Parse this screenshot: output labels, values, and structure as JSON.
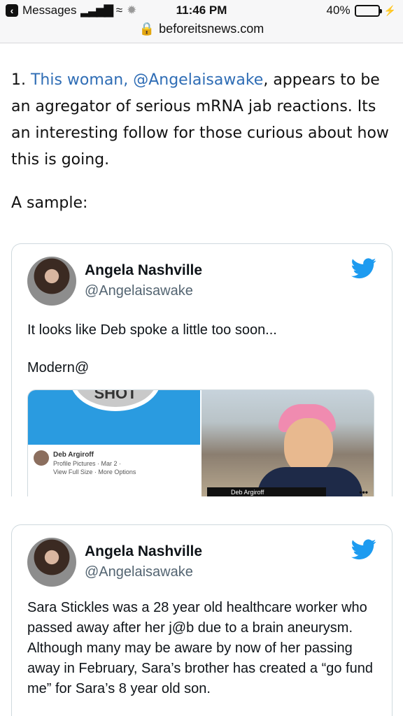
{
  "status_bar": {
    "back_app": "Messages",
    "time": "11:46 PM",
    "battery": "40%",
    "battery_level": 0.4
  },
  "browser": {
    "url": "beforeitsnews.com"
  },
  "article": {
    "para1_prefix": "1. ",
    "para1_link": "This woman, @Angelaisawake",
    "para1_rest": ", appears to be an agregator of serious mRNA jab reactions. Its an interesting follow for those curious about how this is going.",
    "para2": "A sample:"
  },
  "tweets": [
    {
      "name": "Angela Nashville",
      "handle": "@Angelaisawake",
      "text_line1": "It looks like Deb spoke a little too soon...",
      "text_line2": "Modern@",
      "media": {
        "left_circle_text": "SHOT",
        "profile_name": "Deb Argiroff",
        "profile_meta": "Profile Pictures · Mar 2 ·",
        "profile_links": "View Full Size · More Options",
        "right_caption": "Deb Argiroff",
        "right_more": "•••"
      }
    },
    {
      "name": "Angela Nashville",
      "handle": "@Angelaisawake",
      "text": "Sara Stickles was a 28 year old healthcare worker who passed away after her j@b due to a brain aneurysm. Although many may be aware by now of her passing away in February, Sara’s brother has created a “go fund me” for Sara’s 8 year old son."
    }
  ],
  "colors": {
    "link": "#2f6db5",
    "twitter_blue": "#1d9bf0"
  }
}
